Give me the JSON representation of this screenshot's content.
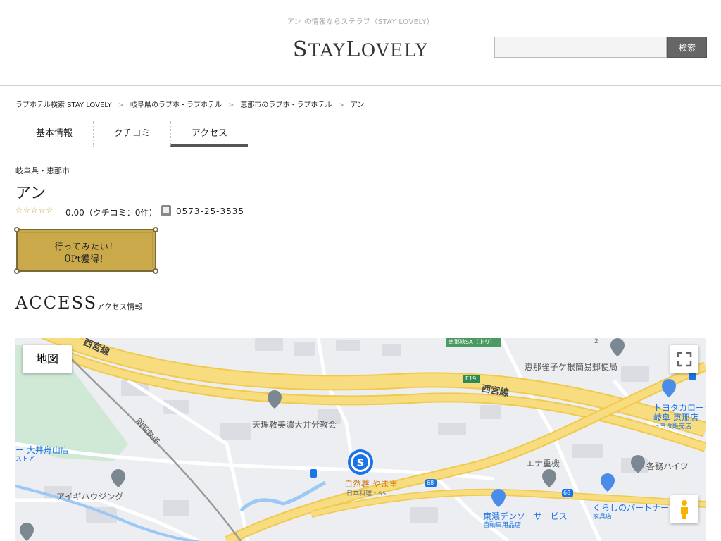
{
  "header": {
    "tagline": "アン の情報ならステラブ（STAY LOVELY）",
    "logo": {
      "s": "S",
      "tay": "TAY",
      "l": "L",
      "ovely": "OVELY"
    },
    "search_placeholder": "",
    "search_button": "検索"
  },
  "breadcrumb": [
    "ラブホテル検索 STAY LOVELY",
    "岐阜県のラブホ・ラブホテル",
    "恵那市のラブホ・ラブホテル",
    "アン"
  ],
  "breadcrumb_sep": ">",
  "tabs": [
    "基本情報",
    "クチコミ",
    "アクセス"
  ],
  "hotel": {
    "area": "岐阜県・恵那市",
    "name": "アン",
    "stars": "☆☆☆☆☆",
    "rating": "0.00（クチコミ：0件）",
    "phone": "0573-25-3535"
  },
  "want_button": {
    "line1": "行ってみたい！",
    "points": "0",
    "pt_unit": "Pt",
    "line2_suffix": "獲得！"
  },
  "access": {
    "title": "ACCESS",
    "subtitle": "アクセス情報"
  },
  "map": {
    "type_button": "地図",
    "labels": {
      "nishimiya_top": "西宮線",
      "nishimiya_right": "西宮線",
      "e19": "E19",
      "ena_sa": "恵那峡SA（上り）",
      "post_office": "恵那雀子ケ根簡易郵便局",
      "toyota": "トヨタカローラ",
      "toyota2": "岐阜 恵那店",
      "toyota3": "トヨタ販売店",
      "tenri": "天理教美濃大井分教会",
      "meichi": "明知鉄道",
      "store": "ー 大井舟山店",
      "store2": "ストア",
      "aigi": "アイギハウジング",
      "yamasato": "自然薯 やま里",
      "yamasato2": "日本料理・$$",
      "ena_juki": "エナ重機",
      "kakumu": "各務ハイツ",
      "tono": "東濃デンソーサービス",
      "tono2": "自動車用品店",
      "kurashi": "くらしのパートナー",
      "kurashi2": "家具店",
      "r68a": "68",
      "r68b": "68",
      "num2": "2"
    }
  },
  "colors": {
    "accent_gold": "#c9a94a",
    "map_highway": "#f6d87a",
    "map_green": "#cfe9d6",
    "map_water": "#9cc8f5",
    "map_blue_poi": "#1a73e8"
  }
}
